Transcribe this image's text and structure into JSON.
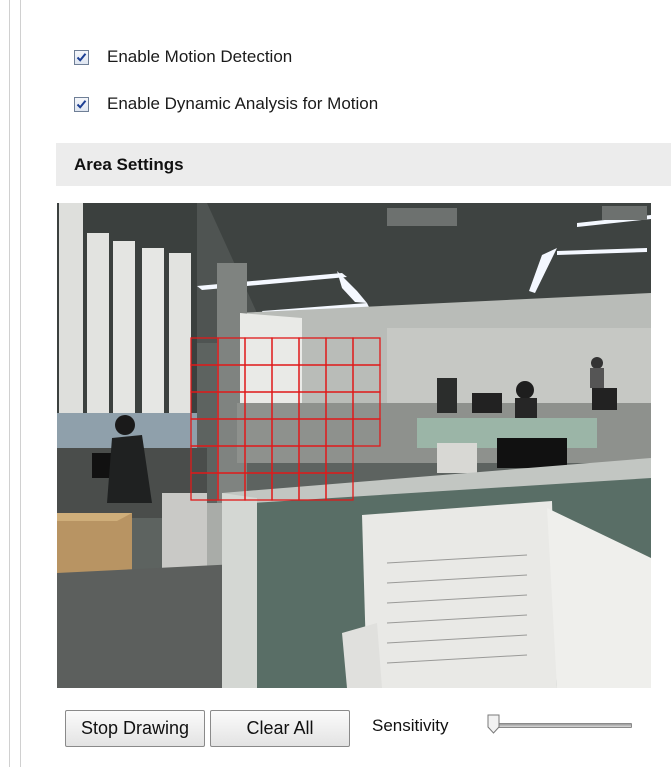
{
  "motion": {
    "enable_motion_label": "Enable Motion Detection",
    "enable_motion_checked": true,
    "enable_dynamic_label": "Enable Dynamic Analysis for Motion",
    "enable_dynamic_checked": true
  },
  "area_settings": {
    "title": "Area Settings",
    "grid_color": "#e01a1a"
  },
  "controls": {
    "stop_drawing_label": "Stop Drawing",
    "clear_all_label": "Clear All",
    "sensitivity_label": "Sensitivity",
    "sensitivity_level": 0
  }
}
